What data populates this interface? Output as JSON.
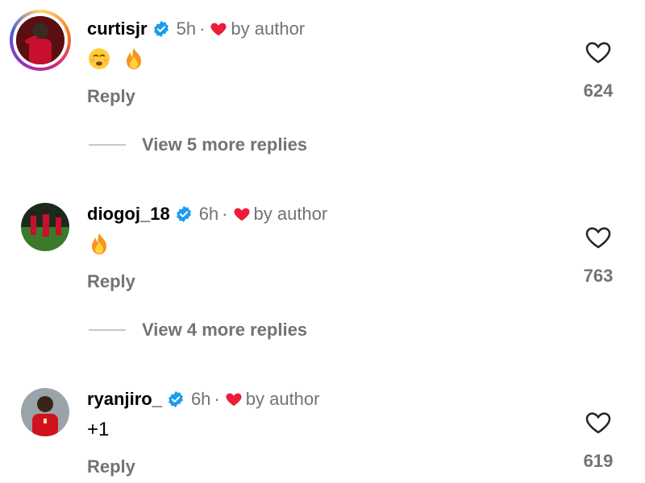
{
  "comments": [
    {
      "username": "curtisjr",
      "time": "5h",
      "separator": "·",
      "by_author": "by author",
      "body": "",
      "emojis": [
        "weary-face",
        "fire"
      ],
      "reply_label": "Reply",
      "like_count": "624",
      "view_more": "View 5 more replies"
    },
    {
      "username": "diogoj_18",
      "time": "6h",
      "separator": "·",
      "by_author": "by author",
      "body": "",
      "emojis": [
        "fire"
      ],
      "reply_label": "Reply",
      "like_count": "763",
      "view_more": "View 4 more replies"
    },
    {
      "username": "ryanjiro_",
      "time": "6h",
      "separator": "·",
      "by_author": "by author",
      "body": "+1",
      "emojis": [],
      "reply_label": "Reply",
      "like_count": "619",
      "view_more": ""
    }
  ],
  "colors": {
    "verified": "#1d9bf0",
    "author_heart": "#ed1c3a",
    "muted_text": "#737373"
  },
  "icons": {
    "verified": "verified-badge-icon",
    "author_heart": "heart-filled-icon",
    "like": "heart-outline-icon"
  }
}
